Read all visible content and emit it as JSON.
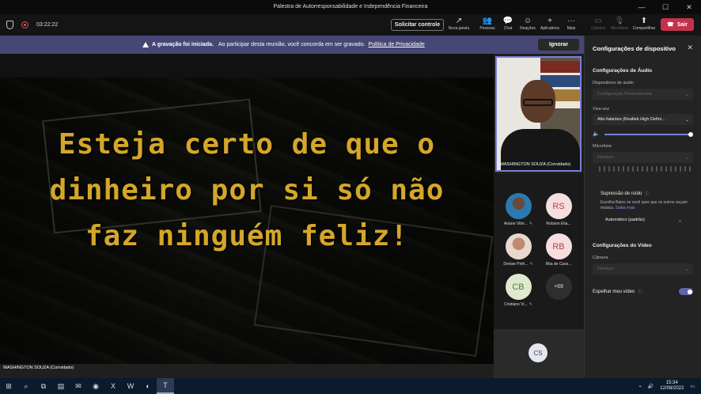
{
  "window": {
    "title": "Palestra de Autorresponsabilidade e Independência Financeira",
    "min": "—",
    "max": "☐",
    "close": "✕"
  },
  "toolbar": {
    "timer": "03:22:22",
    "control_label": "Solicitar controle",
    "buttons": [
      {
        "label": "Nova janela",
        "icon": "↗"
      },
      {
        "label": "Pessoas",
        "icon": "👥"
      },
      {
        "label": "Chat",
        "icon": "💬"
      },
      {
        "label": "Reações",
        "icon": "☺"
      },
      {
        "label": "Aplicativos",
        "icon": "+"
      },
      {
        "label": "Mais",
        "icon": "···"
      },
      {
        "label": "Câmera",
        "icon": "▭"
      },
      {
        "label": "Microfone",
        "icon": "🎙"
      },
      {
        "label": "Compartilhar",
        "icon": "⬆"
      }
    ],
    "leave_label": "Sair",
    "leave_icon": "☎"
  },
  "banner": {
    "title": "A gravação foi iniciada.",
    "text": "Ao participar desta reunião, você concorda em ser gravado.",
    "link": "Política de Privacidade",
    "ignore": "Ignorar"
  },
  "stage": {
    "quote_lines": [
      "Esteja certo de que o",
      "dinheiro por si só não",
      "faz ninguém feliz!"
    ],
    "presenter_label": "WASHINGTON SOUZA (Convidado)"
  },
  "presenter": {
    "name": "WASHINGTON SOUZA (Convidado)"
  },
  "participants": [
    {
      "initials": "",
      "name": "Ariane Vitór...",
      "style": "photo1"
    },
    {
      "initials": "RS",
      "name": "Robson Elia...",
      "style": "rs"
    },
    {
      "initials": "",
      "name": "Denise Pinh...",
      "style": "photo2"
    },
    {
      "initials": "RB",
      "name": "Rita de Cass...",
      "style": "rb"
    },
    {
      "initials": "CB",
      "name": "Cristiano Vi...",
      "style": "cb"
    },
    {
      "initials": "+69",
      "name": "",
      "style": "more"
    }
  ],
  "self_tile": {
    "initials": "CS"
  },
  "settings": {
    "title": "Configurações de dispositivo",
    "audio_section": "Configurações de Áudio",
    "audio_devices_label": "Dispositivos de áudio",
    "audio_devices_value": "Configuração Personalizada",
    "speaker_label": "Viva-voz",
    "speaker_value": "Alto-falantes (Realtek High Defini...",
    "speaker_volume": 1.0,
    "mic_label": "Microfone",
    "mic_value": "Nenhum",
    "noise_title": "Supressão de ruído",
    "noise_desc": "Escolha Baixo se você quer que os outros ouçam música.",
    "noise_link": "Saiba mais",
    "noise_value": "Automático (padrão)",
    "video_section": "Configurações do Vídeo",
    "camera_label": "Câmera",
    "camera_value": "Nenhum",
    "mirror_label": "Espelhar meu vídeo",
    "mirror_on": true
  },
  "taskbar": {
    "time": "15:34",
    "date": "12/08/2022",
    "icons": [
      "⊞",
      "⌕",
      "⧉",
      "▤",
      "✉",
      "◉",
      "X",
      "W",
      "◐",
      "T"
    ]
  }
}
